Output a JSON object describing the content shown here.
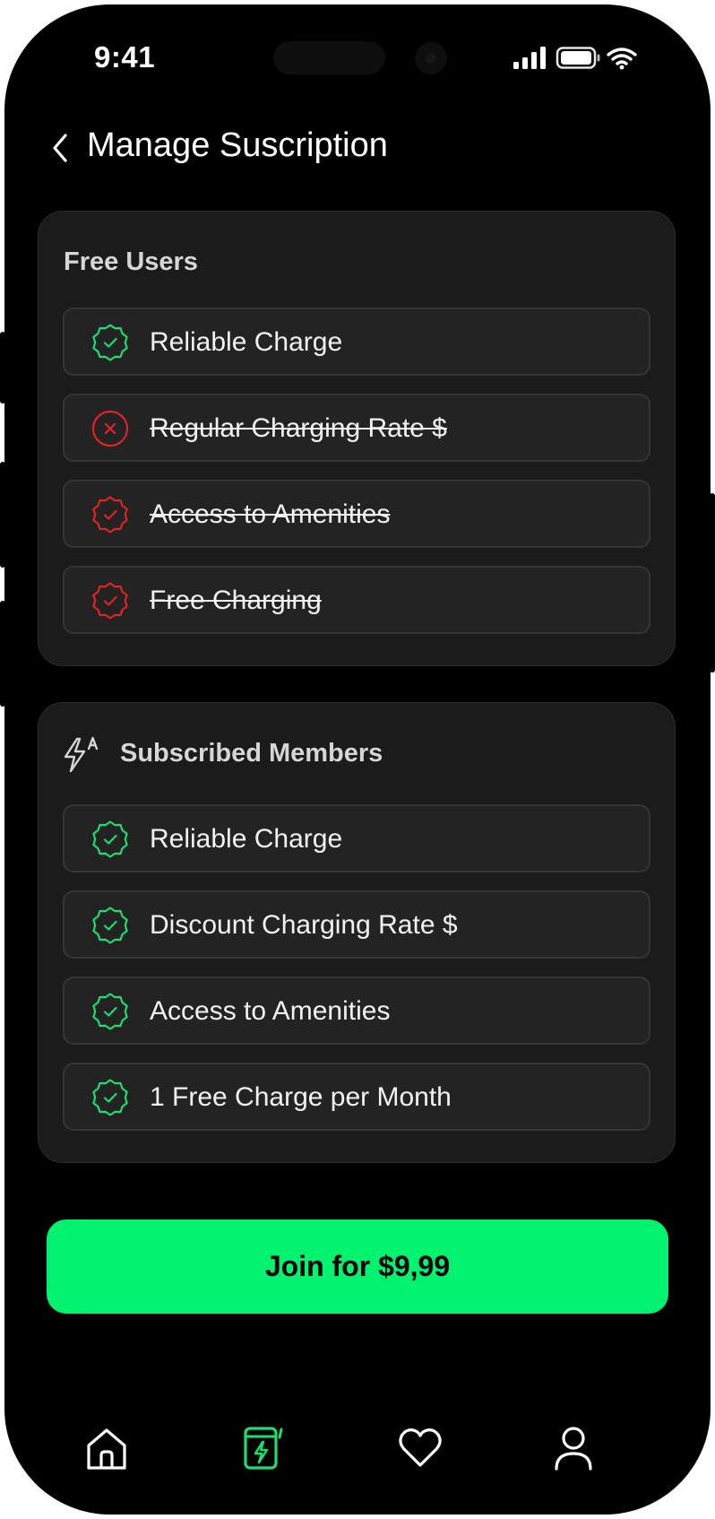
{
  "status_bar": {
    "time": "9:41"
  },
  "header": {
    "title": "Manage Suscription",
    "back_icon": "chevron-left-icon"
  },
  "free_users": {
    "title": "Free Users",
    "items": [
      {
        "label": "Reliable Charge",
        "icon": "badge-check-icon",
        "color": "#1fdc72",
        "struck": false
      },
      {
        "label": "Regular Charging Rate $",
        "icon": "circle-x-icon",
        "color": "#e02424",
        "struck": true
      },
      {
        "label": "Access to Amenities",
        "icon": "badge-check-icon",
        "color": "#e02424",
        "struck": true
      },
      {
        "label": "Free Charging",
        "icon": "badge-check-icon",
        "color": "#e02424",
        "struck": true
      }
    ]
  },
  "subscribed_members": {
    "title": "Subscribed Members",
    "title_icon": "flash-auto-icon",
    "items": [
      {
        "label": "Reliable Charge",
        "icon": "badge-check-icon",
        "color": "#1fdc72",
        "struck": false
      },
      {
        "label": "Discount Charging Rate $",
        "icon": "badge-check-icon",
        "color": "#1fdc72",
        "struck": false
      },
      {
        "label": "Access to Amenities",
        "icon": "badge-check-icon",
        "color": "#1fdc72",
        "struck": false
      },
      {
        "label": "1 Free Charge per Month",
        "icon": "badge-check-icon",
        "color": "#1fdc72",
        "struck": false
      }
    ]
  },
  "cta": {
    "label": "Join for $9,99"
  },
  "tabbar": {
    "tabs": [
      {
        "name": "home",
        "icon": "home-icon",
        "active": false
      },
      {
        "name": "charging",
        "icon": "charging-station-icon",
        "active": true
      },
      {
        "name": "favorites",
        "icon": "heart-icon",
        "active": false
      },
      {
        "name": "profile",
        "icon": "user-icon",
        "active": false
      }
    ]
  },
  "colors": {
    "accent": "#00f26f",
    "positive": "#1fdc72",
    "negative": "#e02424",
    "background": "#000000",
    "card": "#1b1b1b"
  }
}
